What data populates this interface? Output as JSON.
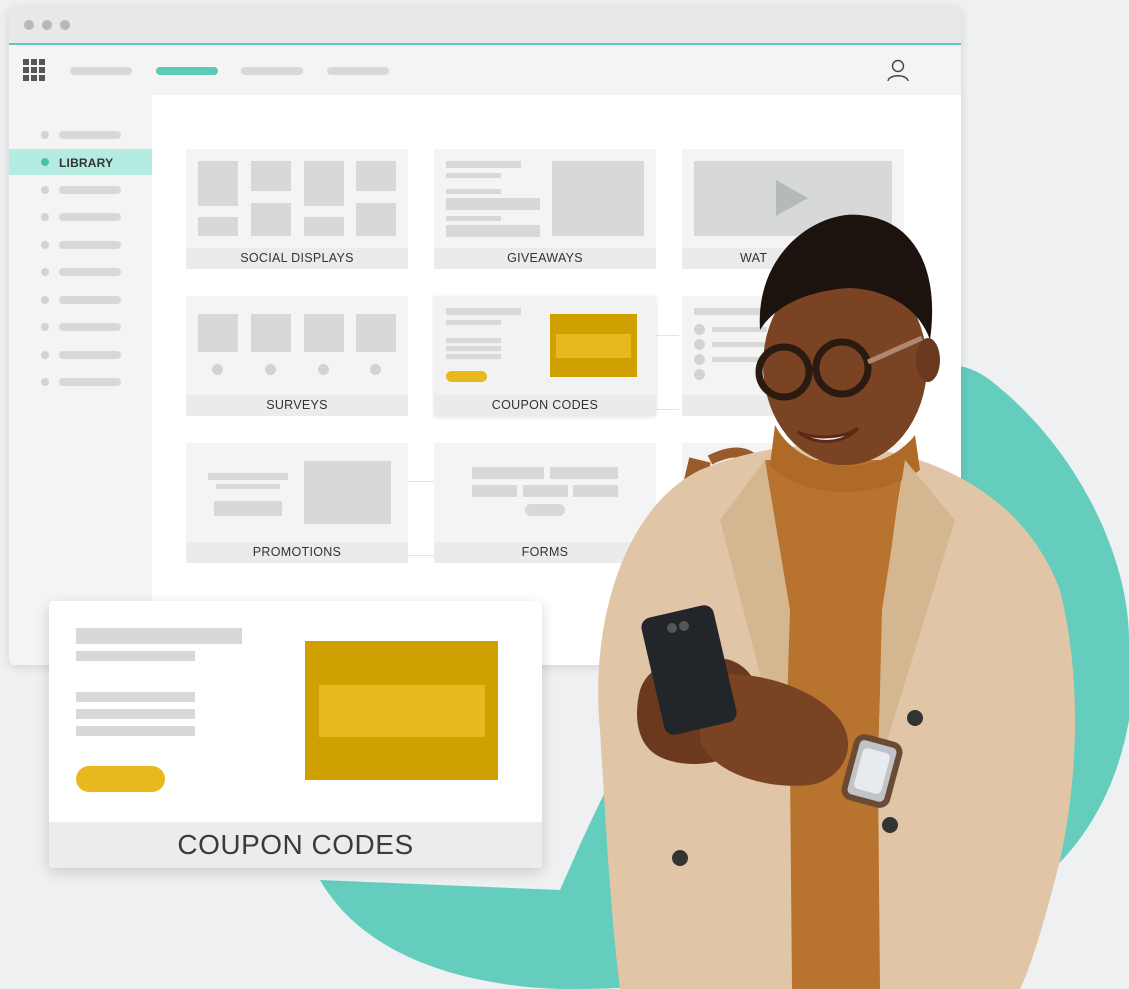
{
  "colors": {
    "accent": "#5ec9b8",
    "sidebar_active": "#b5ece2",
    "coupon_dark": "#cfa000",
    "coupon_light": "#e8b81e",
    "coat": "#e0c6a6"
  },
  "navbar": {
    "menu_icon": "grid-icon",
    "user_icon": "user-icon"
  },
  "sidebar": {
    "active_label": "LIBRARY"
  },
  "tiles": {
    "social_displays": "SOCIAL DISPLAYS",
    "giveaways": "GIVEAWAYS",
    "watch_partial": "WAT",
    "surveys": "SURVEYS",
    "coupon_codes": "COUPON CODES",
    "promotions": "PROMOTIONS",
    "forms": "FORMS"
  },
  "coupon_card": {
    "label": "COUPON CODES"
  }
}
